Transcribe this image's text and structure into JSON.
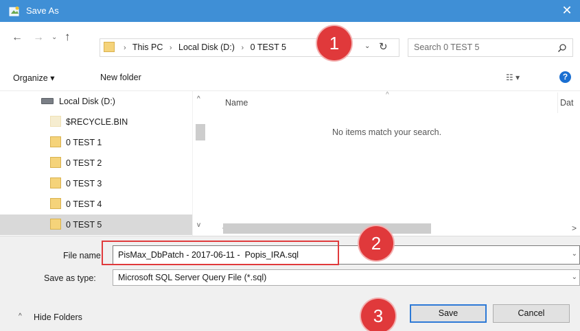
{
  "window": {
    "title": "Save As",
    "close_glyph": "✕",
    "icon": "save-as-app-icon"
  },
  "nav": {
    "back_glyph": "←",
    "forward_glyph": "→",
    "recent_glyph": "⌄",
    "up_glyph": "↑"
  },
  "address": {
    "crumbs": [
      "This PC",
      "Local Disk (D:)",
      "0 TEST 5"
    ],
    "separator": "›",
    "dropdown_glyph": "⌄",
    "refresh_glyph": "↻"
  },
  "search": {
    "placeholder": "Search 0 TEST 5",
    "icon": "search-icon"
  },
  "callouts": [
    "1",
    "2",
    "3"
  ],
  "toolbar": {
    "organize_label": "Organize ▾",
    "new_folder_label": "New folder",
    "view_label": "☷ ▾",
    "help_label": "?"
  },
  "tree": {
    "drive": "Local Disk (D:)",
    "items": [
      "$RECYCLE.BIN",
      "0 TEST 1",
      "0 TEST 2",
      "0 TEST 3",
      "0 TEST 4",
      "0 TEST 5"
    ],
    "selected": "0 TEST 5"
  },
  "scroll": {
    "up_glyph": "^",
    "down_glyph": "v",
    "left_glyph": "<",
    "right_glyph": ">"
  },
  "files": {
    "col_name": "Name",
    "col_date": "Dat",
    "sort_glyph": "^",
    "empty_message": "No items match your search."
  },
  "form": {
    "file_name_label": "File name:",
    "file_name_value": "PisMax_DbPatch - 2017-06-11 -  Popis_IRA.sql",
    "save_type_label": "Save as type:",
    "save_type_value": "Microsoft SQL Server Query File (*.sql)",
    "dropdown_glyph": "⌄"
  },
  "footer": {
    "hide_folders_glyph": "^",
    "hide_folders_label": "Hide Folders",
    "save_label": "Save",
    "cancel_label": "Cancel"
  },
  "colors": {
    "titlebar": "#3f8fd6",
    "callout": "#e0393b",
    "highlight_box": "#e0393b",
    "default_button_border": "#2c79d6"
  }
}
